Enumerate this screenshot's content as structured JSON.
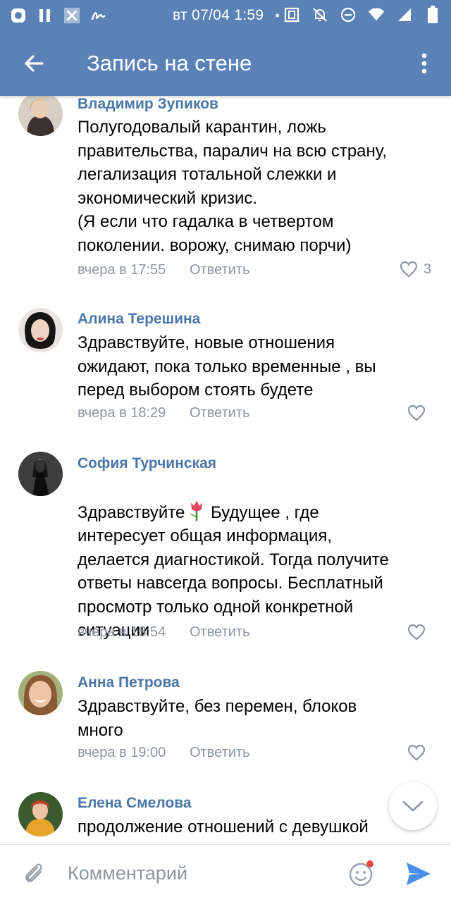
{
  "status_bar": {
    "datetime": "вт 07/04 1:59",
    "dot": "•"
  },
  "header": {
    "title": "Запись на стене",
    "back_icon": "arrow-left-icon",
    "more_icon": "more-vertical-icon"
  },
  "colors": {
    "header_bg": "#5b82b6",
    "name_link": "#4a76a8",
    "meta_gray": "#8e959e",
    "send_blue": "#4a8ee8",
    "badge_red": "#e64646"
  },
  "comments": [
    {
      "author": "Владимир Зупиков",
      "text": "Полугодовалый карантин, ложь\nправительства, паралич на всю страну,\nлегализация тотальной слежки и\nэкономический кризис.\n(Я если что гадалка в четвертом\nпоколении. ворожу, снимаю порчи)",
      "time": "вчера в 17:55",
      "reply": "Ответить",
      "likes": "3"
    },
    {
      "author": "Алина Терешина",
      "text": "Здравствуйте, новые отношения\nожидают, пока только временные , вы\nперед выбором стоять будете",
      "time": "вчера в 18:29",
      "reply": "Ответить",
      "likes": ""
    },
    {
      "author": "София Турчинская",
      "text_before_emoji": "Здравствуйте",
      "emoji": "tulip-emoji",
      "text": " Будущее , где\nинтересует общая информация,\nделается диагностикой. Тогда получите\nответы навсегда вопросы. Бесплатный\nпросмотр только одной конкретной\nситуации",
      "time": "вчера в 18:54",
      "reply": "Ответить",
      "likes": ""
    },
    {
      "author": "Анна Петрова",
      "text": "Здравствуйте, без перемен, блоков\nмного",
      "time": "вчера в 19:00",
      "reply": "Ответить",
      "likes": ""
    },
    {
      "author": "Елена Смелова",
      "text": "продолжение отношений с девушкой",
      "time": "",
      "reply": "",
      "likes": ""
    }
  ],
  "input_bar": {
    "placeholder": "Комментарий",
    "value": ""
  }
}
